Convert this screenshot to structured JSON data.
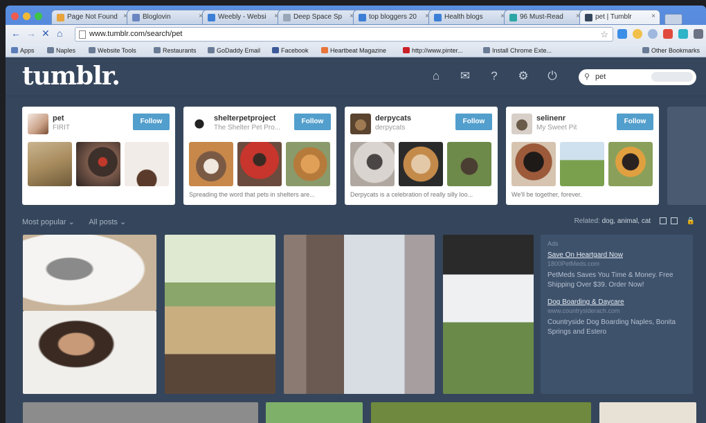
{
  "browser": {
    "tabs": [
      {
        "label": "Page Not Found",
        "color": "#e8a33a"
      },
      {
        "label": "Bloglovin",
        "color": "#6a86c2"
      },
      {
        "label": "Weebly - Websi",
        "color": "#3d7fd6"
      },
      {
        "label": "Deep Space Sp",
        "color": "#9aa7b8"
      },
      {
        "label": "top bloggers 20",
        "color": "#3d7fd6"
      },
      {
        "label": "Health blogs",
        "color": "#3d7fd6"
      },
      {
        "label": "96 Must-Read",
        "color": "#2ca6a4"
      },
      {
        "label": "pet | Tumblr",
        "color": "#36465d"
      }
    ],
    "url": "www.tumblr.com/search/pet",
    "bookmarks": [
      {
        "label": "Apps",
        "color": "#5b7db8"
      },
      {
        "label": "Naples",
        "color": "#6a7b95"
      },
      {
        "label": "Website Tools",
        "color": "#6a7b95"
      },
      {
        "label": "Restaurants",
        "color": "#6a7b95"
      },
      {
        "label": "GoDaddy Email",
        "color": "#6a7b95"
      },
      {
        "label": "Facebook",
        "color": "#3b5998"
      },
      {
        "label": "Heartbeat Magazine",
        "color": "#e8743a"
      },
      {
        "label": "http://www.pinter...",
        "color": "#cb2027"
      },
      {
        "label": "Install Chrome Exte...",
        "color": "#6a7b95"
      },
      {
        "label": "Other Bookmarks",
        "color": "#6a7b95"
      }
    ]
  },
  "tumblr": {
    "logo": "tumblr.",
    "search_value": "pet",
    "cards": [
      {
        "name": "pet",
        "sub": "FIRIT",
        "desc": "",
        "follow": "Follow"
      },
      {
        "name": "shelterpetproject",
        "sub": "The Shelter Pet Pro...",
        "desc": "Spreading the word that pets in shelters are...",
        "follow": "Follow"
      },
      {
        "name": "derpycats",
        "sub": "derpycats",
        "desc": "Derpycats is a celebration of really silly loo...",
        "follow": "Follow"
      },
      {
        "name": "selinenr",
        "sub": "My Sweet Pit",
        "desc": "We'll be together, forever.",
        "follow": "Follow"
      }
    ],
    "filters": {
      "sort": "Most popular ⌄",
      "type": "All posts ⌄"
    },
    "related_label": "Related:",
    "related_tags": "dog, animal, cat",
    "ad": {
      "label": "Ads",
      "items": [
        {
          "title": "Save On Heartgard Now",
          "link": "1800PetMeds.com",
          "text": "PetMeds Saves You Time & Money. Free Shipping Over $39. Order Now!"
        },
        {
          "title": "Dog Boarding & Daycare",
          "link": "www.countrysiderach.com",
          "text": "Countryside Dog Boarding Naples, Bonita Springs and Estero"
        }
      ]
    }
  }
}
